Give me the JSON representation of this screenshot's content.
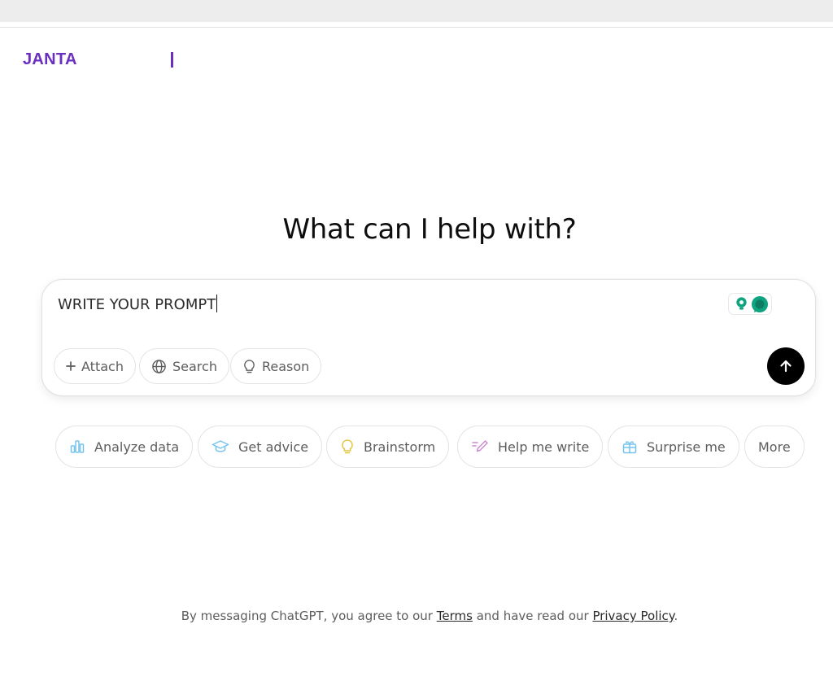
{
  "brand": {
    "name": "JANTA"
  },
  "main": {
    "headline": "What can I help with?"
  },
  "composer": {
    "input_value": "WRITE YOUR PROMPT",
    "buttons": {
      "attach": "Attach",
      "search": "Search",
      "reason": "Reason"
    },
    "send_icon": "arrow-up-icon",
    "extension_icons": [
      "lightbulb-icon",
      "chat-bubble-icon"
    ]
  },
  "suggestions": [
    {
      "label": "Analyze data",
      "icon": "bar-chart-icon",
      "color": "#76c4ee"
    },
    {
      "label": "Get advice",
      "icon": "graduation-cap-icon",
      "color": "#76c4ee"
    },
    {
      "label": "Brainstorm",
      "icon": "lightbulb-icon",
      "color": "#e2c541"
    },
    {
      "label": "Help me write",
      "icon": "pen-icon",
      "color": "#cb8bd0"
    },
    {
      "label": "Surprise me",
      "icon": "gift-icon",
      "color": "#76c4ee"
    },
    {
      "label": "More",
      "icon": "",
      "color": ""
    }
  ],
  "footer": {
    "prefix": "By messaging ChatGPT, you agree to our ",
    "terms": "Terms",
    "middle": " and have read our ",
    "privacy": "Privacy Policy",
    "suffix": "."
  },
  "colors": {
    "brand": "#6a2fc0",
    "send_button": "#000000",
    "extension_accent": "#10a37f"
  }
}
